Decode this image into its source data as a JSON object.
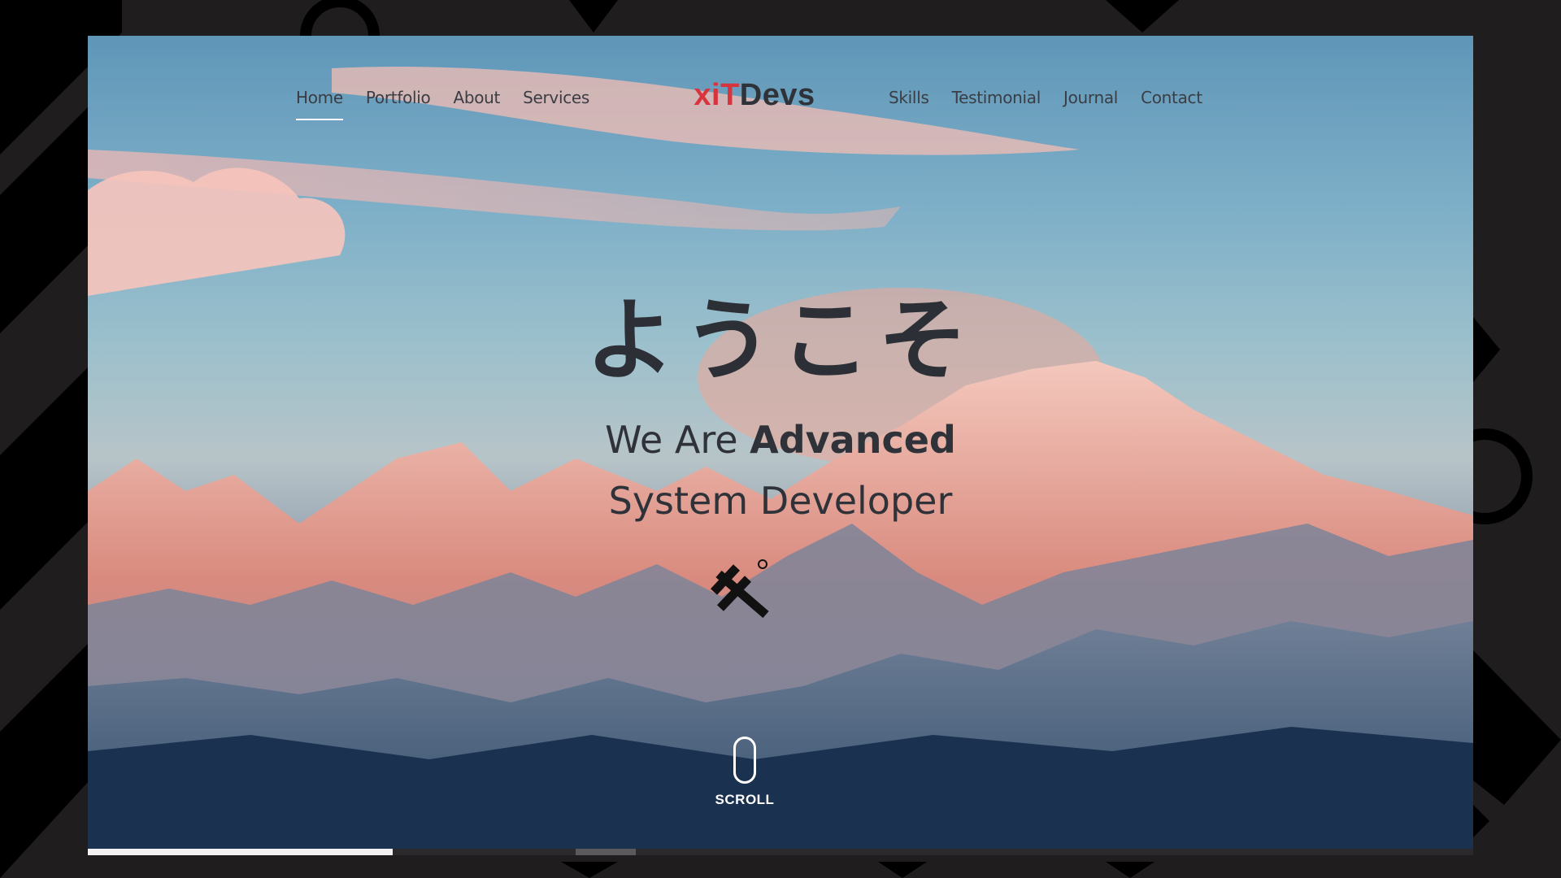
{
  "nav": {
    "left": [
      "Home",
      "Portfolio",
      "About",
      "Services"
    ],
    "right": [
      "Skills",
      "Testimonial",
      "Journal",
      "Contact"
    ],
    "active": "Home"
  },
  "logo": {
    "part1": "xiT",
    "part2": "Devs"
  },
  "hero": {
    "welcome": "ようこそ",
    "line1_prefix": "We Are ",
    "line1_bold": "Advanced",
    "line2": "System Developer"
  },
  "scroll": {
    "label": "SCROLL"
  },
  "progress": {
    "fraction": 0.22
  },
  "colors": {
    "accent": "#d8343e",
    "text": "#2f3339",
    "frame": "#1f1d1d"
  },
  "icons": {
    "mark": "brand-cross-mark-icon",
    "scroll": "mouse-scroll-icon"
  }
}
